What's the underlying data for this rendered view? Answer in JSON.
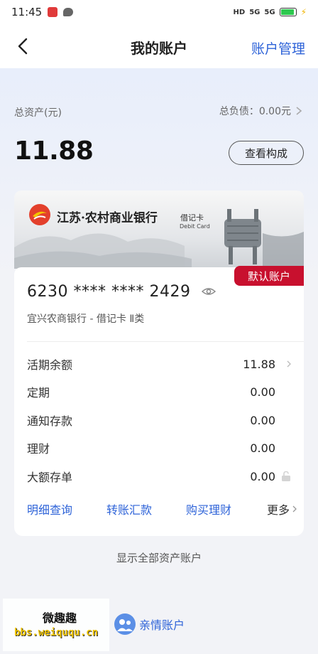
{
  "status_bar": {
    "time": "11:45",
    "network_hd": "HD",
    "signal_1": "5G",
    "signal_2": "5G",
    "battery_level": 0.9
  },
  "header": {
    "title": "我的账户",
    "manage_label": "账户管理"
  },
  "summary": {
    "asset_label": "总资产(元)",
    "debt_label": "总负债：0.00元",
    "asset_total": "11.88",
    "compose_button": "查看构成"
  },
  "card": {
    "bank_name": "江苏·农村商业银行",
    "card_type_cn": "借记卡",
    "card_type_en": "Debit Card",
    "default_badge": "默认账户",
    "number": "6230 **** **** 2429",
    "subtitle": "宜兴农商银行 - 借记卡 Ⅱ类",
    "balances": [
      {
        "label": "活期余额",
        "value": "11.88"
      },
      {
        "label": "定期",
        "value": "0.00"
      },
      {
        "label": "通知存款",
        "value": "0.00"
      },
      {
        "label": "理财",
        "value": "0.00"
      },
      {
        "label": "大额存单",
        "value": "0.00"
      }
    ],
    "actions": {
      "detail": "明细查询",
      "transfer": "转账汇款",
      "wealth": "购买理财",
      "more": "更多"
    }
  },
  "show_all_label": "显示全部资产账户",
  "family_account_label": "亲情账户",
  "watermark": {
    "top": "微趣趣",
    "bottom": "bbs.weiququ.cn"
  },
  "colors": {
    "accent": "#2e63d8",
    "badge": "#c8102e",
    "background": "#f2f3f7"
  }
}
